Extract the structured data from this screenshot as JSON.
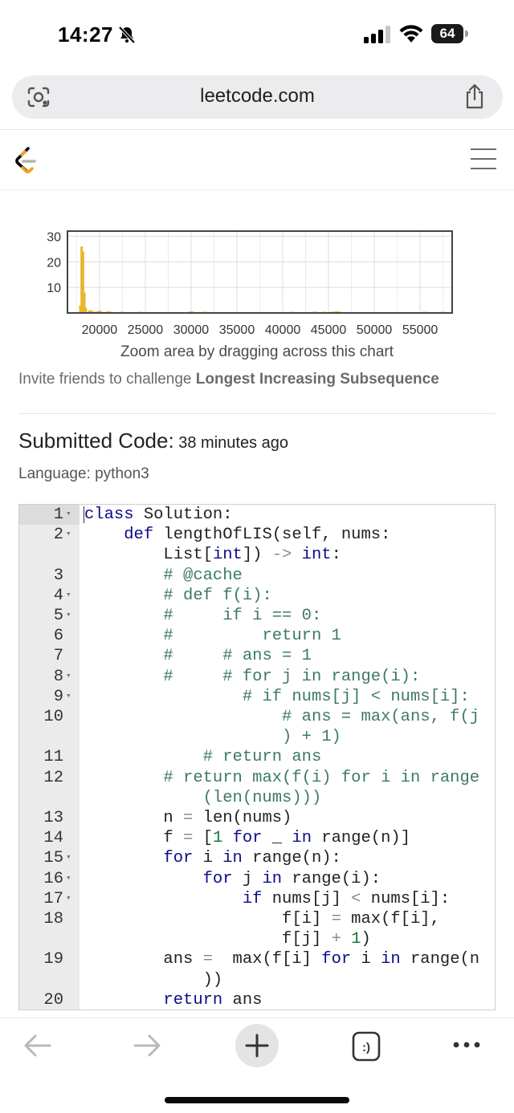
{
  "status_bar": {
    "time": "14:27",
    "battery": "64"
  },
  "browser": {
    "url": "leetcode.com"
  },
  "chart_data": {
    "type": "bar",
    "yticks": [
      "30",
      "20",
      "10"
    ],
    "xticks": [
      "20000",
      "25000",
      "30000",
      "35000",
      "40000",
      "45000",
      "50000",
      "55000"
    ],
    "xlim": [
      16500,
      58500
    ],
    "ylim": [
      0,
      32
    ],
    "bar_color": "#e8b730",
    "x": [
      17900,
      18050,
      18200,
      18350,
      18500,
      19000,
      19500,
      20000,
      21000,
      22500,
      24500,
      30000,
      31500,
      41000,
      43500,
      44500,
      45500,
      46000,
      55500,
      57500
    ],
    "values": [
      3,
      26,
      24,
      8,
      2,
      1,
      0.5,
      0.8,
      0.6,
      0.4,
      0.4,
      0.6,
      0.4,
      0.4,
      0.5,
      0.4,
      0.5,
      0.6,
      0.4,
      0.4
    ]
  },
  "chart_caption": "Zoom area by dragging across this chart",
  "invite": {
    "prefix": "Invite friends to challenge ",
    "problem": "Longest Increasing Subsequence"
  },
  "submission": {
    "heading": "Submitted Code:",
    "time": " 38 minutes ago",
    "language": "Language: python3"
  },
  "code_lines": [
    {
      "n": "1",
      "fold": "▾",
      "html": "<span class='kw'>class</span> Solution:"
    },
    {
      "n": "2",
      "fold": "▾",
      "html": "    <span class='kw'>def</span> lengthOfLIS(self, nums:"
    },
    {
      "n": "",
      "fold": "",
      "html": "        List[<span class='kw'>int</span>]) <span class='op'>-></span> <span class='kw'>int</span>:"
    },
    {
      "n": "3",
      "fold": "",
      "html": "        <span class='cm'># @cache</span>"
    },
    {
      "n": "4",
      "fold": "▾",
      "html": "        <span class='cm'># def f(i):</span>"
    },
    {
      "n": "5",
      "fold": "▾",
      "html": "        <span class='cm'>#     if i == 0:</span>"
    },
    {
      "n": "6",
      "fold": "",
      "html": "        <span class='cm'>#         return 1</span>"
    },
    {
      "n": "7",
      "fold": "",
      "html": "        <span class='cm'>#     # ans = 1</span>"
    },
    {
      "n": "8",
      "fold": "▾",
      "html": "        <span class='cm'>#     # for j in range(i):</span>"
    },
    {
      "n": "9",
      "fold": "▾",
      "html": "                <span class='cm'># if nums[j] < nums[i]:</span>"
    },
    {
      "n": "10",
      "fold": "",
      "html": "                    <span class='cm'># ans = max(ans, f(j</span>"
    },
    {
      "n": "",
      "fold": "",
      "html": "                    <span class='cm'>) + 1)</span>"
    },
    {
      "n": "11",
      "fold": "",
      "html": "            <span class='cm'># return ans</span>"
    },
    {
      "n": "12",
      "fold": "",
      "html": "        <span class='cm'># return max(f(i) for i in range</span>"
    },
    {
      "n": "",
      "fold": "",
      "html": "            <span class='cm'>(len(nums)))</span>"
    },
    {
      "n": "13",
      "fold": "",
      "html": "        n <span class='op'>=</span> len(nums)"
    },
    {
      "n": "14",
      "fold": "",
      "html": "        f <span class='op'>=</span> [<span class='num'>1</span> <span class='kw'>for</span> _ <span class='kw'>in</span> range(n)]"
    },
    {
      "n": "15",
      "fold": "▾",
      "html": "        <span class='kw'>for</span> i <span class='kw'>in</span> range(n):"
    },
    {
      "n": "16",
      "fold": "▾",
      "html": "            <span class='kw'>for</span> j <span class='kw'>in</span> range(i):"
    },
    {
      "n": "17",
      "fold": "▾",
      "html": "                <span class='kw'>if</span> nums[j] <span class='op'><</span> nums[i]:"
    },
    {
      "n": "18",
      "fold": "",
      "html": "                    f[i] <span class='op'>=</span> max(f[i],"
    },
    {
      "n": "",
      "fold": "",
      "html": "                    f[j] <span class='op'>+</span> <span class='num'>1</span>)"
    },
    {
      "n": "19",
      "fold": "",
      "html": "        ans <span class='op'>=</span>  max(f[i] <span class='kw'>for</span> i <span class='kw'>in</span> range(n"
    },
    {
      "n": "",
      "fold": "",
      "html": "            ))"
    },
    {
      "n": "20",
      "fold": "",
      "html": "        <span class='kw'>return</span> ans"
    }
  ],
  "toolbar": {
    "back": "back-arrow-icon",
    "forward": "forward-arrow-icon",
    "new_tab": "plus-icon",
    "tabs": "tabs-icon",
    "more": "more-icon"
  }
}
